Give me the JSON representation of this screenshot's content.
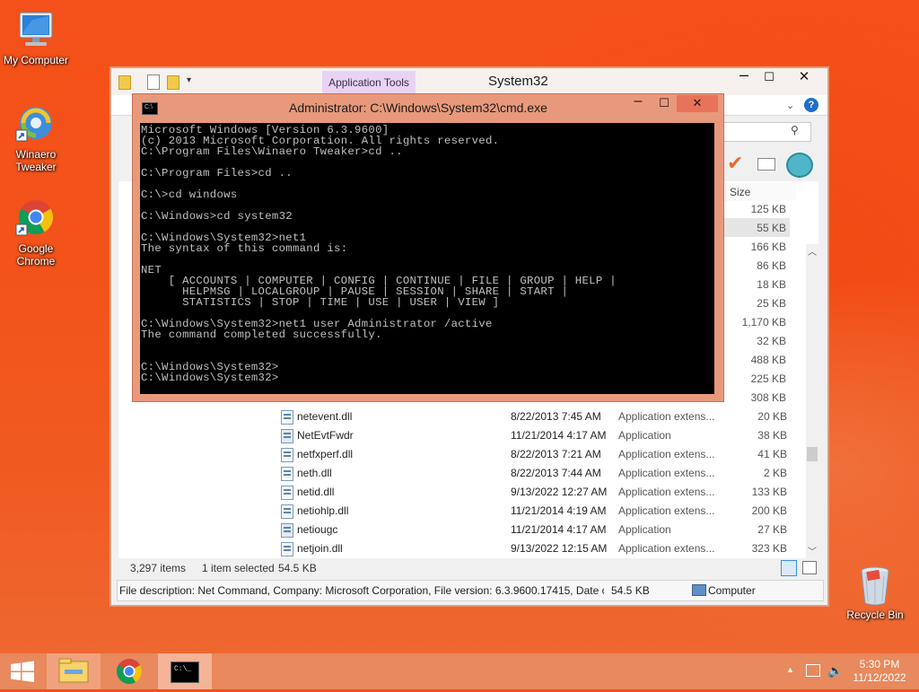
{
  "desktop": {
    "icons": [
      {
        "label": "My Computer",
        "icon": "computer-icon"
      },
      {
        "label": "Winaero Tweaker",
        "icon": "winaero-tweaker-icon"
      },
      {
        "label": "Google Chrome",
        "icon": "chrome-icon"
      },
      {
        "label": "Recycle Bin",
        "icon": "recycle-bin-icon"
      }
    ]
  },
  "explorer": {
    "title": "System32",
    "contextual_tab": "Application Tools",
    "column_size": "Size",
    "visible_sizes": [
      "125 KB",
      "55 KB",
      "166 KB",
      "86 KB",
      "18 KB",
      "25 KB",
      "1,170 KB",
      "32 KB",
      "488 KB",
      "225 KB",
      "308 KB"
    ],
    "rows": [
      {
        "name": "netevent.dll",
        "date": "8/22/2013 7:45 AM",
        "type": "Application extens...",
        "size": "20 KB",
        "kind": "dll"
      },
      {
        "name": "NetEvtFwdr",
        "date": "11/21/2014 4:17 AM",
        "type": "Application",
        "size": "38 KB",
        "kind": "app"
      },
      {
        "name": "netfxperf.dll",
        "date": "8/22/2013 7:21 AM",
        "type": "Application extens...",
        "size": "41 KB",
        "kind": "dll"
      },
      {
        "name": "neth.dll",
        "date": "8/22/2013 7:44 AM",
        "type": "Application extens...",
        "size": "2 KB",
        "kind": "dll"
      },
      {
        "name": "netid.dll",
        "date": "9/13/2022 12:27 AM",
        "type": "Application extens...",
        "size": "133 KB",
        "kind": "dll"
      },
      {
        "name": "netiohlp.dll",
        "date": "11/21/2014 4:19 AM",
        "type": "Application extens...",
        "size": "200 KB",
        "kind": "dll"
      },
      {
        "name": "netiougc",
        "date": "11/21/2014 4:17 AM",
        "type": "Application",
        "size": "27 KB",
        "kind": "app"
      },
      {
        "name": "netjoin.dll",
        "date": "9/13/2022 12:15 AM",
        "type": "Application extens...",
        "size": "323 KB",
        "kind": "dll"
      }
    ],
    "status": {
      "items_count": "3,297 items",
      "selected": "1 item selected",
      "selected_size": "54.5 KB"
    },
    "details_bar": {
      "description": "File description: Net Command, Company: Microsoft Corporation, File version: 6.3.9600.17415, Date cre",
      "size": "54.5 KB",
      "location": "Computer"
    }
  },
  "cmd": {
    "title": "Administrator: C:\\Windows\\System32\\cmd.exe",
    "output": "Microsoft Windows [Version 6.3.9600]\n(c) 2013 Microsoft Corporation. All rights reserved.\nC:\\Program Files\\Winaero Tweaker>cd ..\n\nC:\\Program Files>cd ..\n\nC:\\>cd windows\n\nC:\\Windows>cd system32\n\nC:\\Windows\\System32>net1\nThe syntax of this command is:\n\nNET\n    [ ACCOUNTS | COMPUTER | CONFIG | CONTINUE | FILE | GROUP | HELP |\n      HELPMSG | LOCALGROUP | PAUSE | SESSION | SHARE | START |\n      STATISTICS | STOP | TIME | USE | USER | VIEW ]\n\nC:\\Windows\\System32>net1 user Administrator /active\nThe command completed successfully.\n\n\nC:\\Windows\\System32>\nC:\\Windows\\System32>"
  },
  "taskbar": {
    "time": "5:30 PM",
    "date": "11/12/2022",
    "pinned": [
      "start-icon",
      "file-explorer-icon",
      "chrome-icon",
      "cmd-icon"
    ]
  },
  "colors": {
    "desktop": "#f3531a",
    "taskbar": "#e8895e",
    "cmd_frame": "#e9997b",
    "accent_close": "#e8735a"
  }
}
